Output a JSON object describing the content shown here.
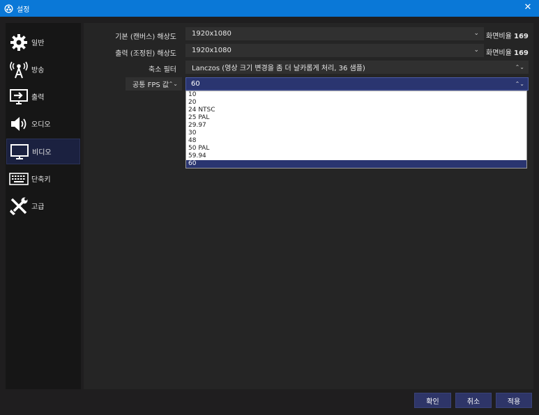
{
  "window": {
    "title": "설정"
  },
  "sidebar": {
    "items": [
      {
        "label": "일반",
        "icon": "gear-icon",
        "active": false
      },
      {
        "label": "방송",
        "icon": "broadcast-antenna-icon",
        "active": false
      },
      {
        "label": "출력",
        "icon": "output-monitor-icon",
        "active": false
      },
      {
        "label": "오디오",
        "icon": "speaker-icon",
        "active": false
      },
      {
        "label": "비디오",
        "icon": "monitor-icon",
        "active": true
      },
      {
        "label": "단축키",
        "icon": "keyboard-icon",
        "active": false
      },
      {
        "label": "고급",
        "icon": "tools-icon",
        "active": false
      }
    ]
  },
  "video": {
    "base_resolution": {
      "label": "기본 (캔버스) 해상도",
      "value": "1920x1080",
      "ratio_prefix": "화면비율",
      "ratio_value": "169"
    },
    "output_resolution": {
      "label": "출력 (조정된) 해상도",
      "value": "1920x1080",
      "ratio_prefix": "화면비율",
      "ratio_value": "169"
    },
    "downscale_filter": {
      "label": "축소 필터",
      "value": "Lanczos (영상 크기 변경을 좀 더 날카롭게 처리, 36 샘플)"
    },
    "fps": {
      "type_label": "공통 FPS 값",
      "value": "60",
      "options": [
        "10",
        "20",
        "24 NTSC",
        "25 PAL",
        "29.97",
        "30",
        "48",
        "50 PAL",
        "59.94",
        "60"
      ],
      "selected_index": 9
    }
  },
  "buttons": {
    "ok": "확인",
    "cancel": "취소",
    "apply": "적용"
  },
  "colors": {
    "titlebar": "#0a78d7",
    "accent": "#2a3570",
    "active_nav": "#1b2140"
  }
}
